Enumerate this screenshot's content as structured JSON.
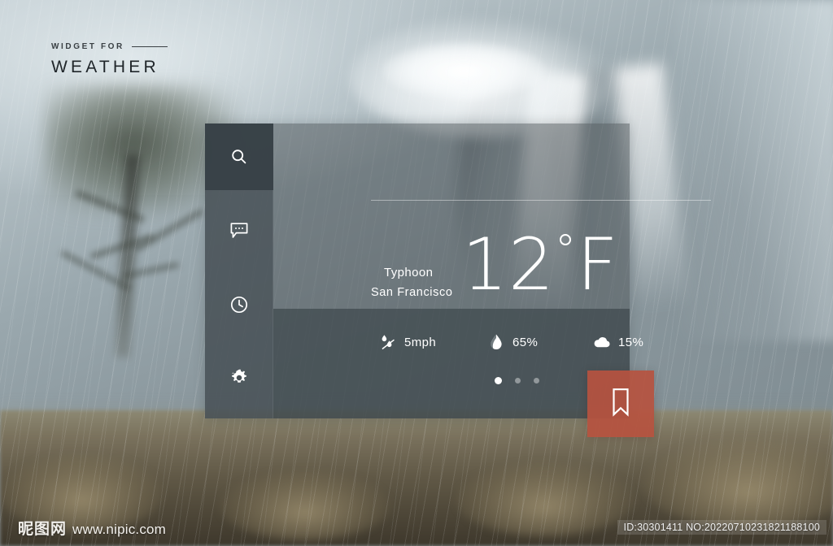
{
  "brand": {
    "kicker": "WIDGET FOR",
    "word": "WEATHER"
  },
  "colors": {
    "accent": "#b6523f",
    "sidebar": "#485156",
    "sidebar_active": "#374146",
    "panel": "#4e565a",
    "panel_lower": "#3a4449",
    "text": "#ffffff"
  },
  "card": {
    "sidebar": {
      "items": [
        {
          "name": "search",
          "icon": "search-icon",
          "active": true
        },
        {
          "name": "messages",
          "icon": "chat-bubble-icon",
          "active": false
        },
        {
          "name": "history",
          "icon": "clock-icon",
          "active": false
        },
        {
          "name": "settings",
          "icon": "gear-icon",
          "active": false
        }
      ]
    },
    "location": "San Francisco",
    "condition": "Typhoon",
    "temperature": {
      "value": "12",
      "degree": "°",
      "unit": "F"
    },
    "stats": [
      {
        "icon": "wind-rain-icon",
        "label": "wind",
        "value": "5mph"
      },
      {
        "icon": "humidity-drop-icon",
        "label": "humidity",
        "value": "65%"
      },
      {
        "icon": "cloud-icon",
        "label": "cloud-cover",
        "value": "15%"
      }
    ],
    "pagination": {
      "count": 3,
      "active_index": 0
    },
    "bookmark": {
      "icon": "bookmark-icon",
      "label": "Bookmark"
    }
  },
  "watermark": {
    "site_cn": "昵图网",
    "site_url": "www.nipic.com",
    "id_line": "ID:30301411 NO:20220710231821188100"
  }
}
